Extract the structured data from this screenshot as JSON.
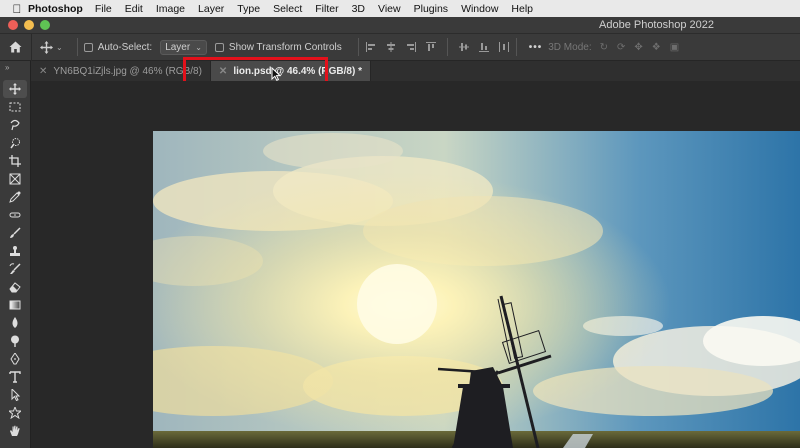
{
  "menubar": {
    "apple_icon": "apple-icon",
    "app_name": "Photoshop",
    "items": [
      "File",
      "Edit",
      "Image",
      "Layer",
      "Type",
      "Select",
      "Filter",
      "3D",
      "View",
      "Plugins",
      "Window",
      "Help"
    ]
  },
  "window": {
    "title": "Adobe Photoshop 2022",
    "traffic_colors": [
      "#ed5f58",
      "#f4be4f",
      "#5fc454"
    ]
  },
  "options": {
    "home_icon": "home-icon",
    "move_icon": "move-tool-icon",
    "auto_select_label": "Auto-Select:",
    "auto_select_checked": false,
    "layer_select_value": "Layer",
    "show_transform_label": "Show Transform Controls",
    "show_transform_checked": false,
    "more_label": "•••",
    "mode3d_label": "3D Mode:"
  },
  "tabs": [
    {
      "label": "YN6BQ1iZjls.jpg @ 46% (RGB/8)",
      "active": false
    },
    {
      "label": "lion.psd @ 46.4% (RGB/8) *",
      "active": true
    }
  ],
  "tools": [
    "move-tool",
    "marquee-tool",
    "lasso-tool",
    "quick-select-tool",
    "crop-tool",
    "frame-tool",
    "eyedropper-tool",
    "healing-brush-tool",
    "brush-tool",
    "clone-stamp-tool",
    "history-brush-tool",
    "eraser-tool",
    "gradient-tool",
    "blur-tool",
    "dodge-tool",
    "pen-tool",
    "type-tool",
    "path-select-tool",
    "shape-tool",
    "hand-tool"
  ],
  "colors": {
    "highlight": "#e3111b",
    "ui_dark": "#3a3a3a",
    "canvas_bg": "#282828"
  }
}
